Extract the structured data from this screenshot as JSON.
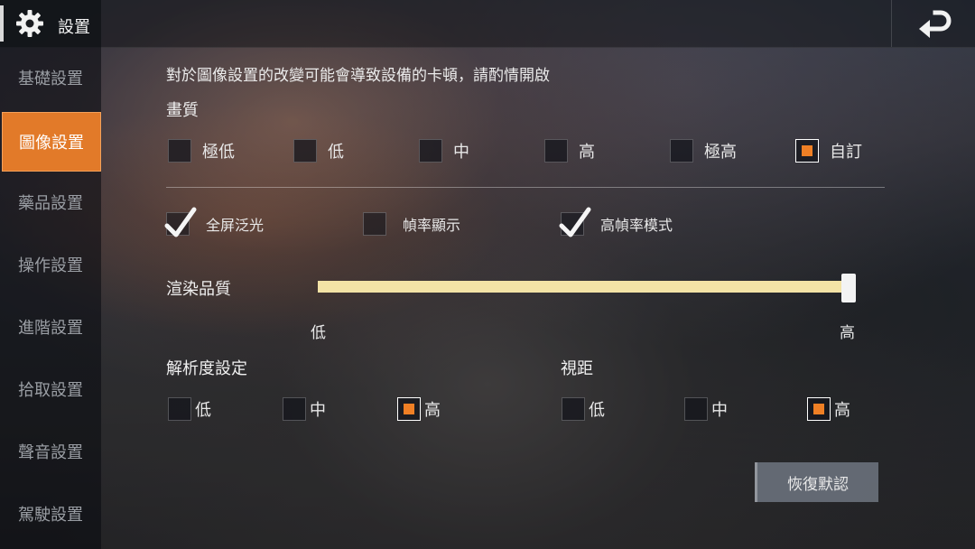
{
  "header": {
    "title": "設置",
    "gear_icon": "gear-icon",
    "back_icon": "return-arrow-icon"
  },
  "sidebar": {
    "items": [
      {
        "label": "基礎設置",
        "active": false
      },
      {
        "label": "圖像設置",
        "active": true
      },
      {
        "label": "藥品設置",
        "active": false
      },
      {
        "label": "操作設置",
        "active": false
      },
      {
        "label": "進階設置",
        "active": false
      },
      {
        "label": "拾取設置",
        "active": false
      },
      {
        "label": "聲音設置",
        "active": false
      },
      {
        "label": "駕駛設置",
        "active": false
      }
    ]
  },
  "main": {
    "warning": "對於圖像設置的改變可能會導致設備的卡頓，請酌情開啟",
    "quality": {
      "title": "畫質",
      "options": [
        {
          "label": "極低",
          "checked": false
        },
        {
          "label": "低",
          "checked": false
        },
        {
          "label": "中",
          "checked": false
        },
        {
          "label": "高",
          "checked": false
        },
        {
          "label": "極高",
          "checked": false
        },
        {
          "label": "自訂",
          "checked": true
        }
      ]
    },
    "toggles": [
      {
        "label": "全屏泛光",
        "checked": true
      },
      {
        "label": "幀率顯示",
        "checked": false
      },
      {
        "label": "高幀率模式",
        "checked": true
      }
    ],
    "render_quality": {
      "label": "渲染品質",
      "min_label": "低",
      "max_label": "高",
      "value": 1.0
    },
    "resolution": {
      "title": "解析度設定",
      "options": [
        {
          "label": "低",
          "checked": false
        },
        {
          "label": "中",
          "checked": false
        },
        {
          "label": "高",
          "checked": true
        }
      ]
    },
    "view_distance": {
      "title": "視距",
      "options": [
        {
          "label": "低",
          "checked": false
        },
        {
          "label": "中",
          "checked": false
        },
        {
          "label": "高",
          "checked": true
        }
      ]
    },
    "reset_label": "恢復默認"
  },
  "colors": {
    "accent": "#e27a29",
    "checked_fill": "#ef7f25",
    "slider_track": "#f0dea0"
  }
}
